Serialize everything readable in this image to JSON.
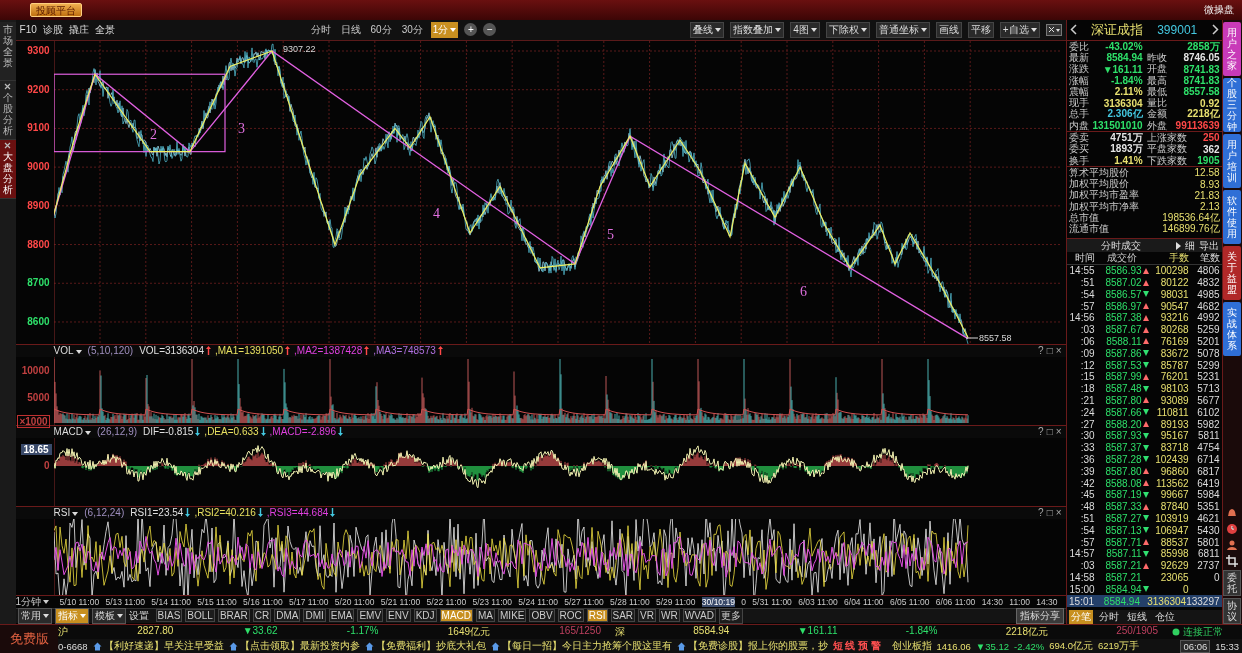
{
  "top_bar": {
    "button": "投顾平台",
    "right_label": "微操盘"
  },
  "side_tabs": [
    {
      "label": "市场全景",
      "closable": false,
      "selected": false
    },
    {
      "label": "个股分析",
      "closable": true,
      "selected": false
    },
    {
      "label": "大盘分析",
      "closable": true,
      "selected": true
    }
  ],
  "toolbar": {
    "left": [
      "F10",
      "诊股",
      "撬庄",
      "全景"
    ],
    "periods": [
      {
        "label": "分时",
        "selected": false
      },
      {
        "label": "日线",
        "selected": false
      },
      {
        "label": "60分",
        "selected": false
      },
      {
        "label": "30分",
        "selected": false
      },
      {
        "label": "1分",
        "selected": true
      }
    ],
    "zoom": [
      "+",
      "−"
    ],
    "right": [
      {
        "label": "叠线",
        "dropdown": true
      },
      {
        "label": "指数叠加",
        "dropdown": true
      },
      {
        "label": "4图",
        "dropdown": true
      },
      {
        "label": "下除权",
        "dropdown": true
      },
      {
        "label": "普通坐标",
        "dropdown": true
      },
      {
        "label": "画线",
        "dropdown": false
      },
      {
        "label": "平移",
        "dropdown": false
      },
      {
        "label": "+自选",
        "dropdown": true
      }
    ]
  },
  "price_chart": {
    "y_ticks": [
      {
        "label": "9300",
        "color": "#ff4848"
      },
      {
        "label": "9200",
        "color": "#ff4848"
      },
      {
        "label": "9100",
        "color": "#ff4848"
      },
      {
        "label": "9000",
        "color": "#ff4848"
      },
      {
        "label": "8900",
        "color": "#ff4848"
      },
      {
        "label": "8800",
        "color": "#ff4848"
      },
      {
        "label": "8700",
        "color": "#2ee06a"
      },
      {
        "label": "8600",
        "color": "#2ee06a"
      }
    ],
    "high_label": "9307.22",
    "low_label": "8557.58",
    "wave_labels": [
      "2",
      "3",
      "4",
      "5",
      "6"
    ]
  },
  "panels": [
    {
      "kind": "vol",
      "name": "VOL",
      "params": "(5,10,120)",
      "values": [
        {
          "text": "VOL=3136304",
          "kind": "rising",
          "color": "#e0e0e0"
        },
        {
          "text": ",MA1=1391050",
          "kind": "rising",
          "color": "#e8e060"
        },
        {
          "text": ",MA2=1387428",
          "kind": "rising",
          "color": "#e040e0"
        },
        {
          "text": ",MA3=748573",
          "kind": "rising",
          "color": "#b070e0"
        }
      ],
      "y_labels": [
        "10000",
        "5000",
        "×1000"
      ],
      "controls": [
        "?",
        "□",
        "×"
      ]
    },
    {
      "kind": "macd",
      "name": "MACD",
      "params": "(26,12,9)",
      "values": [
        {
          "text": "DIF=-0.815",
          "kind": "falling",
          "color": "#e0e0e0"
        },
        {
          "text": ",DEA=0.633",
          "kind": "falling",
          "color": "#e8e060"
        },
        {
          "text": ",MACD=-2.896",
          "kind": "falling",
          "color": "#e040e0"
        }
      ],
      "y_labels": [
        "18.65",
        "0"
      ],
      "controls": [
        "?",
        "□",
        "×"
      ]
    },
    {
      "kind": "rsi",
      "name": "RSI",
      "params": "(6,12,24)",
      "values": [
        {
          "text": "RSI1=23.54",
          "kind": "falling",
          "color": "#e0e0e0"
        },
        {
          "text": ",RSI2=40.216",
          "kind": "falling",
          "color": "#e8e060"
        },
        {
          "text": ",RSI3=44.684",
          "kind": "falling",
          "color": "#e040e0"
        }
      ],
      "controls": [
        "?",
        "□",
        "×"
      ]
    }
  ],
  "x_axis": {
    "period": "1分钟",
    "labels": [
      {
        "text": "5/10 11:00",
        "cursor": false
      },
      {
        "text": "5/13 11:00",
        "cursor": false
      },
      {
        "text": "5/14 11:00",
        "cursor": false
      },
      {
        "text": "5/15 11:00",
        "cursor": false
      },
      {
        "text": "5/16 11:00",
        "cursor": false
      },
      {
        "text": "5/17 11:00",
        "cursor": false
      },
      {
        "text": "5/20 11:00",
        "cursor": false
      },
      {
        "text": "5/21 11:00",
        "cursor": false
      },
      {
        "text": "5/22 11:00",
        "cursor": false
      },
      {
        "text": "5/23 11:00",
        "cursor": false
      },
      {
        "text": "5/24 11:00",
        "cursor": false
      },
      {
        "text": "5/27 11:00",
        "cursor": false
      },
      {
        "text": "5/28 11:00",
        "cursor": false
      },
      {
        "text": "5/29 11:00",
        "cursor": false
      },
      {
        "text": "30/10:19",
        "cursor": true
      },
      {
        "text": "0",
        "cursor": false
      },
      {
        "text": "5/31 11:00",
        "cursor": false
      },
      {
        "text": "6/03 11:00",
        "cursor": false
      },
      {
        "text": "6/04 11:00",
        "cursor": false
      },
      {
        "text": "6/05 11:00",
        "cursor": false
      },
      {
        "text": "6/06 11:00",
        "cursor": false
      },
      {
        "text": "14:30",
        "cursor": false
      },
      {
        "text": "11:00",
        "cursor": false
      },
      {
        "text": "14:30",
        "cursor": false
      }
    ]
  },
  "indicator_bar": {
    "menus": [
      {
        "label": "常用",
        "selected": false
      },
      {
        "label": "指标",
        "selected": true
      },
      {
        "label": "模板",
        "selected": false
      }
    ],
    "settings": "设置",
    "indicators": [
      {
        "label": "BIAS",
        "selected": false
      },
      {
        "label": "BOLL",
        "selected": false
      },
      {
        "label": "BRAR",
        "selected": false
      },
      {
        "label": "CR",
        "selected": false
      },
      {
        "label": "DMA",
        "selected": false
      },
      {
        "label": "DMI",
        "selected": false
      },
      {
        "label": "EMA",
        "selected": false
      },
      {
        "label": "EMV",
        "selected": false
      },
      {
        "label": "ENV",
        "selected": false
      },
      {
        "label": "KDJ",
        "selected": false
      },
      {
        "label": "MACD",
        "selected": true
      },
      {
        "label": "MA",
        "selected": false
      },
      {
        "label": "MIKE",
        "selected": false
      },
      {
        "label": "OBV",
        "selected": false
      },
      {
        "label": "ROC",
        "selected": false
      },
      {
        "label": "RSI",
        "selected": true
      },
      {
        "label": "SAR",
        "selected": false
      },
      {
        "label": "VR",
        "selected": false
      },
      {
        "label": "WR",
        "selected": false
      },
      {
        "label": "WVAD",
        "selected": false
      },
      {
        "label": "更多",
        "selected": false
      }
    ],
    "share": "指标分享"
  },
  "quote_panel": {
    "name": "深证成指",
    "code": "399001",
    "stats": [
      [
        {
          "label": "委比",
          "value": "-43.02%",
          "color": "#2ee06a"
        },
        {
          "value": "2858万",
          "color": "#2ee06a"
        }
      ],
      [
        {
          "label": "最新",
          "value": "8584.94",
          "color": "#2ee06a"
        },
        {
          "label": "昨收",
          "value": "8746.05",
          "color": "#e6e6e6"
        }
      ],
      [
        {
          "label": "涨跌",
          "value": "▼161.11",
          "color": "#2ee06a"
        },
        {
          "label": "开盘",
          "value": "8741.83",
          "color": "#2ee06a"
        }
      ],
      [
        {
          "label": "涨幅",
          "value": "-1.84%",
          "color": "#2ee06a"
        },
        {
          "label": "最高",
          "value": "8741.83",
          "color": "#2ee06a"
        }
      ],
      [
        {
          "label": "震幅",
          "value": "2.11%",
          "color": "#e8e070"
        },
        {
          "label": "最低",
          "value": "8557.58",
          "color": "#2ee06a"
        }
      ],
      [
        {
          "label": "现手",
          "value": "3136304",
          "color": "#e8e070"
        },
        {
          "label": "量比",
          "value": "0.92",
          "color": "#e8e070"
        }
      ],
      [
        {
          "label": "总手",
          "value": "2.306亿",
          "color": "#44c8e0"
        },
        {
          "label": "金额",
          "value": "2218亿",
          "color": "#e8e070"
        }
      ],
      [
        {
          "label": "内盘",
          "value": "131501010",
          "color": "#2ee06a"
        },
        {
          "label": "外盘",
          "value": "99113639",
          "color": "#ff4848"
        }
      ],
      [
        {
          "label": "委卖",
          "value": "4751万",
          "color": "#e6e6e6"
        },
        {
          "label": "上涨家数",
          "value": "250",
          "color": "#ff4848"
        }
      ],
      [
        {
          "label": "委买",
          "value": "1893万",
          "color": "#e6e6e6"
        },
        {
          "label": "平盘家数",
          "value": "362",
          "color": "#e6e6e6"
        }
      ],
      [
        {
          "label": "换手",
          "value": "1.41%",
          "color": "#e8e070"
        },
        {
          "label": "下跌家数",
          "value": "1905",
          "color": "#2ee06a"
        }
      ]
    ],
    "averages": [
      {
        "label": "算术平均股价",
        "value": "12.58"
      },
      {
        "label": "加权平均股价",
        "value": "8.93"
      },
      {
        "label": "加权平均市盈率",
        "value": "21.83"
      },
      {
        "label": "加权平均市净率",
        "value": "2.13"
      },
      {
        "label": "总市值",
        "value": "198536.64亿"
      },
      {
        "label": "流通市值",
        "value": "146899.76亿"
      }
    ],
    "trades_title": "分时成交",
    "detail": "细",
    "export": "导出",
    "columns": [
      "时间",
      "成交价",
      "手数",
      "笔数"
    ],
    "trades": [
      {
        "time": "14:55",
        "price": "8586.93",
        "kind": "up",
        "volume": "100298",
        "count": "4806",
        "selected": false
      },
      {
        "time": ":51",
        "price": "8587.02",
        "kind": "up",
        "volume": "80122",
        "count": "4832",
        "selected": false
      },
      {
        "time": ":54",
        "price": "8586.57",
        "kind": "down",
        "volume": "98031",
        "count": "4985",
        "selected": false
      },
      {
        "time": ":57",
        "price": "8586.97",
        "kind": "up",
        "volume": "90547",
        "count": "4682",
        "selected": false
      },
      {
        "time": "14:56",
        "price": "8587.38",
        "kind": "up",
        "volume": "93216",
        "count": "4992",
        "selected": false
      },
      {
        "time": ":03",
        "price": "8587.67",
        "kind": "up",
        "volume": "80268",
        "count": "5259",
        "selected": false
      },
      {
        "time": ":06",
        "price": "8588.11",
        "kind": "up",
        "volume": "76169",
        "count": "5201",
        "selected": false
      },
      {
        "time": ":09",
        "price": "8587.86",
        "kind": "down",
        "volume": "83672",
        "count": "5078",
        "selected": false
      },
      {
        "time": ":12",
        "price": "8587.53",
        "kind": "down",
        "volume": "85787",
        "count": "5299",
        "selected": false
      },
      {
        "time": ":15",
        "price": "8587.99",
        "kind": "up",
        "volume": "76201",
        "count": "5231",
        "selected": false
      },
      {
        "time": ":18",
        "price": "8587.48",
        "kind": "down",
        "volume": "98103",
        "count": "5713",
        "selected": false
      },
      {
        "time": ":21",
        "price": "8587.80",
        "kind": "up",
        "volume": "93089",
        "count": "5677",
        "selected": false
      },
      {
        "time": ":24",
        "price": "8587.66",
        "kind": "down",
        "volume": "110811",
        "count": "6102",
        "selected": false
      },
      {
        "time": ":27",
        "price": "8588.20",
        "kind": "up",
        "volume": "89193",
        "count": "5982",
        "selected": false
      },
      {
        "time": ":30",
        "price": "8587.93",
        "kind": "down",
        "volume": "95167",
        "count": "5811",
        "selected": false
      },
      {
        "time": ":33",
        "price": "8587.37",
        "kind": "down",
        "volume": "83718",
        "count": "4754",
        "selected": false
      },
      {
        "time": ":36",
        "price": "8587.28",
        "kind": "down",
        "volume": "102439",
        "count": "6714",
        "selected": false
      },
      {
        "time": ":39",
        "price": "8587.80",
        "kind": "up",
        "volume": "96860",
        "count": "6817",
        "selected": false
      },
      {
        "time": ":42",
        "price": "8588.08",
        "kind": "up",
        "volume": "113562",
        "count": "6419",
        "selected": false
      },
      {
        "time": ":45",
        "price": "8587.19",
        "kind": "down",
        "volume": "99667",
        "count": "5984",
        "selected": false
      },
      {
        "time": ":48",
        "price": "8587.33",
        "kind": "up",
        "volume": "87840",
        "count": "5351",
        "selected": false
      },
      {
        "time": ":51",
        "price": "8587.27",
        "kind": "down",
        "volume": "103919",
        "count": "4621",
        "selected": false
      },
      {
        "time": ":54",
        "price": "8587.13",
        "kind": "down",
        "volume": "106947",
        "count": "5430",
        "selected": false
      },
      {
        "time": ":57",
        "price": "8587.71",
        "kind": "up",
        "volume": "88537",
        "count": "5801",
        "selected": false
      },
      {
        "time": "14:57",
        "price": "8587.11",
        "kind": "down",
        "volume": "85998",
        "count": "6811",
        "selected": false
      },
      {
        "time": ":03",
        "price": "8587.21",
        "kind": "up",
        "volume": "92629",
        "count": "2737",
        "selected": false
      },
      {
        "time": "14:58",
        "price": "8587.21",
        "kind": "flat",
        "volume": "23065",
        "count": "0",
        "selected": false
      },
      {
        "time": "15:00",
        "price": "8584.94",
        "kind": "down",
        "volume": "0",
        "selected": false
      },
      {
        "time": "15:01",
        "price": "8584.94",
        "kind": "flat",
        "volume": "3136304",
        "count": "133297",
        "selected": true
      }
    ],
    "bottom_tabs": [
      {
        "label": "分笔",
        "selected": true
      },
      {
        "label": "分时",
        "selected": false
      },
      {
        "label": "短线",
        "selected": false
      },
      {
        "label": "仓位",
        "selected": false
      }
    ]
  },
  "right_tabs": [
    {
      "label": "用户之家",
      "color": "#c83ab8"
    },
    {
      "label": "个股三分钟",
      "color": "#2f6fd6"
    },
    {
      "label": "用户培训",
      "color": "#2f6fd6"
    },
    {
      "label": "软件使用",
      "color": "#2f6fd6"
    },
    {
      "label": "关于益盟",
      "color": "#b02828"
    },
    {
      "label": "实战体系",
      "color": "#2f6fd6"
    }
  ],
  "right_buttons": [
    "委托",
    "协议"
  ],
  "status_bar": {
    "edition": "免费版",
    "markets": [
      {
        "name": "沪",
        "index": "2827.80",
        "change": "▼33.62",
        "percent": "-1.17%",
        "amount": "1649亿元",
        "breadth": "165/1250"
      },
      {
        "name": "深",
        "index": "8584.94",
        "change": "▼161.11",
        "percent": "-1.84%",
        "amount": "2218亿元",
        "breadth": "250/1905"
      }
    ],
    "connection": "连接正常"
  },
  "ticker": {
    "code": "0-6668",
    "promos": [
      "【利好速递】早关注早受益",
      "【点击领取】最新投资内参",
      "【免费福利】抄底大礼包",
      "【每日一招】今日主力抢筹个股这里有",
      "【免费诊股】报上你的股票，抄"
    ],
    "alert": "短 线 预 警",
    "index": {
      "name": "创业板指",
      "value": "1416.06",
      "change": "▼35.12",
      "percent": "-2.42%",
      "amount": "694.0亿元",
      "volume": "6219万手"
    },
    "date": "06:06",
    "time": "15:33"
  }
}
